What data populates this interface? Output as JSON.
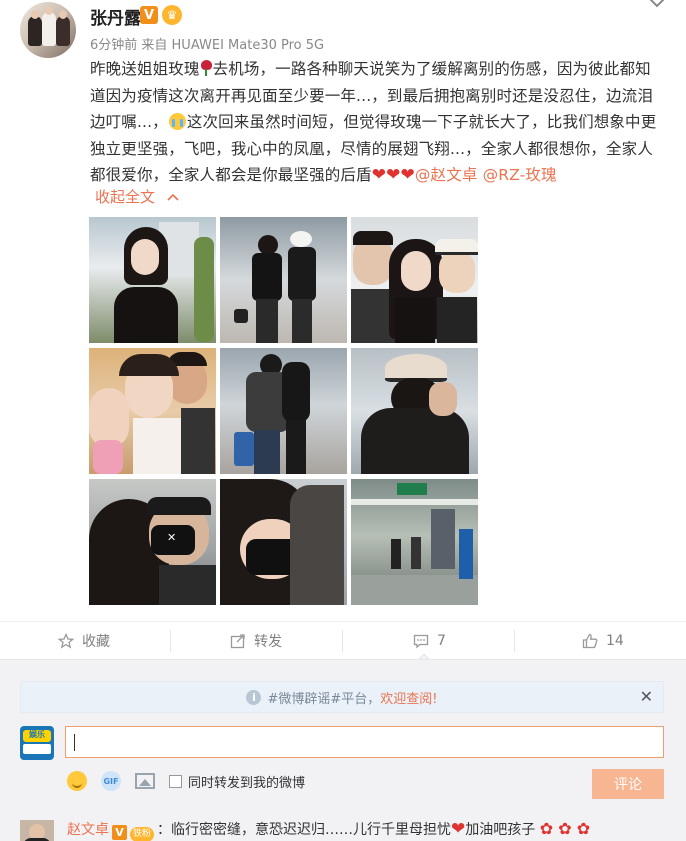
{
  "post": {
    "username": "张丹露",
    "badge_v": "V",
    "badge_crown": "♛",
    "meta": "6分钟前 来自 HUAWEI Mate30 Pro 5G",
    "content_part1": "昨晚送姐姐玫瑰",
    "content_part2": "去机场，一路各种聊天说笑为了缓解离别的伤感，因为彼此都知道因为疫情这次离开再见面至少要一年...，到最后拥抱离别时还是没忍住，边流泪边叮嘱...，",
    "content_part3": "这次回来虽然时间短，但觉得玫瑰一下子就长大了，比我们想象中更独立更坚强，飞吧，我心中的凤凰，尽情的展翅飞翔...，全家人都很想你，全家人都很爱你，全家人都会是你最坚强的后盾",
    "hearts": "❤❤❤",
    "mention1": "@赵文卓",
    "mention2": "@RZ-玫瑰",
    "collapse_label": "收起全文",
    "collapse_icon": "chevron-up-icon"
  },
  "actions": {
    "favorite_label": "收藏",
    "repost_label": "转发",
    "comment_count": "7",
    "like_count": "14"
  },
  "comment_area": {
    "notice_prefix": "#微博辟谣#平台，",
    "notice_link": "欢迎查阅!",
    "input_value": "",
    "checkbox_label": "同时转发到我的微博",
    "submit_label": "评论",
    "avatar_label": "娱乐"
  },
  "comment": {
    "author": "赵文卓",
    "badge_v": "V",
    "fan_badge": "铁粉",
    "text": "：临行密密缝，意恐迟迟归……儿行千里母担忧",
    "text2": "加油吧孩子",
    "heart": "❤",
    "flowers": "✿ ✿ ✿"
  },
  "colors": {
    "accent": "#eb7350",
    "vip": "#f28f1a",
    "link_blue": "#3e8ed6"
  }
}
